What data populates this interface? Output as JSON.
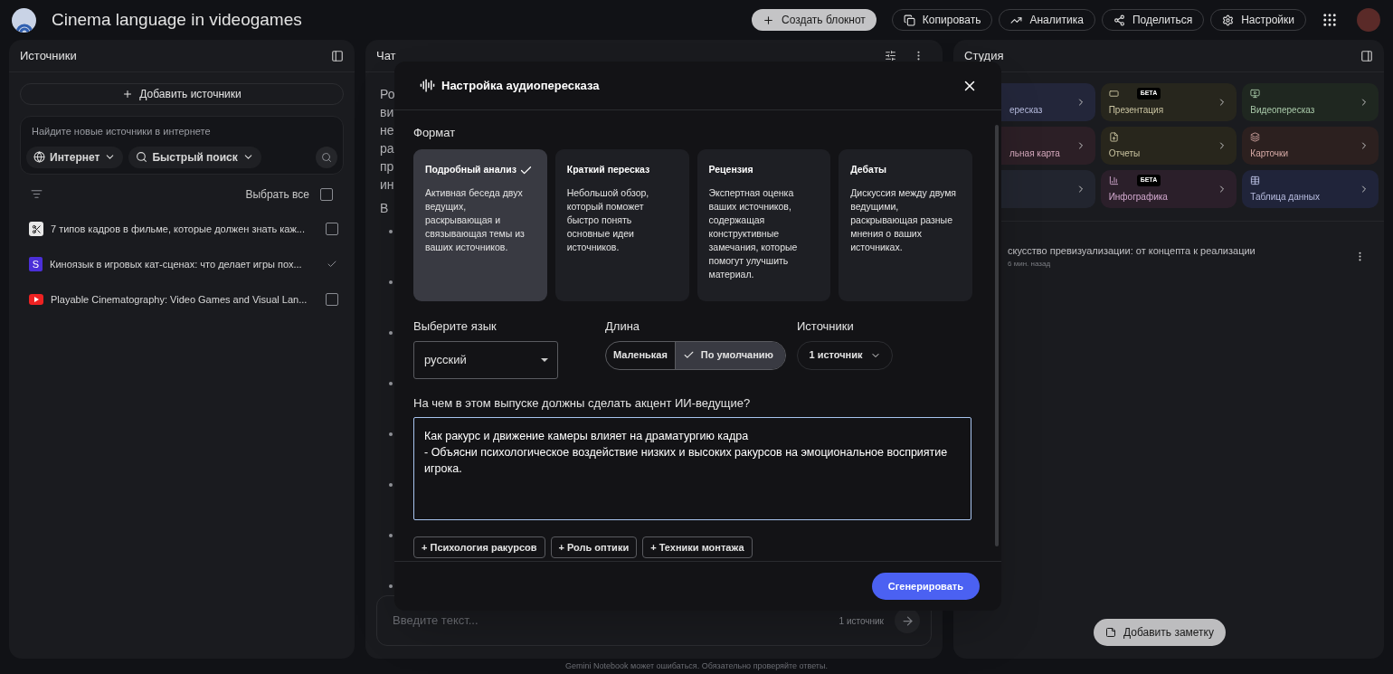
{
  "header": {
    "title": "Cinema language in videogames",
    "buttons": [
      {
        "kind": "create",
        "label": "Создать блокнот"
      },
      {
        "kind": "copy",
        "label": "Копировать"
      },
      {
        "kind": "analytics",
        "label": "Аналитика"
      },
      {
        "kind": "share",
        "label": "Поделиться"
      },
      {
        "kind": "settings",
        "label": "Настройки"
      }
    ]
  },
  "sources": {
    "title": "Источники",
    "add_button": "Добавить источники",
    "search": {
      "placeholder": "Найдите новые источники в интернете",
      "chips": [
        {
          "kind": "web",
          "label": "Интернет"
        },
        {
          "kind": "fast",
          "label": "Быстрый поиск"
        }
      ]
    },
    "select_all": {
      "label": "Выбрать все",
      "checked": false
    },
    "items": [
      {
        "kind": "app",
        "title": "7 типов кадров в фильме, которые должен знать каж...",
        "checked": false
      },
      {
        "kind": "letter",
        "icon_text": "S",
        "title": "Киноязык в игровых кат-сценах: что делает игры пох...",
        "checked": true
      },
      {
        "kind": "video",
        "title": "Playable Cinematography: Video Games and Visual Lan...",
        "checked": false
      }
    ]
  },
  "chat": {
    "title": "Чат",
    "visible_lines": [
      "Ро",
      "ви",
      "не",
      "ра",
      "пр",
      "ин",
      "В"
    ],
    "input": {
      "placeholder": "Введите текст...",
      "source_count": "1 источник"
    }
  },
  "studio": {
    "title": "Студия",
    "tiles": [
      {
        "kind": "audio",
        "label": "ересказ",
        "color": "#23263a"
      },
      {
        "kind": "slides",
        "label": "Презентация",
        "color": "#27261d",
        "badge": "БЕТА"
      },
      {
        "kind": "video",
        "label": "Видеопересказ",
        "color": "#1f2720"
      },
      {
        "kind": "mindmap",
        "label": "льная карта",
        "color": "#2c1f26"
      },
      {
        "kind": "reports",
        "label": "Отчеты",
        "color": "#28261c"
      },
      {
        "kind": "cards",
        "label": "Карточки",
        "color": "#2c201f"
      },
      {
        "kind": "quiz",
        "color": "#22252f"
      },
      {
        "kind": "infographic",
        "label": "Инфографика",
        "color": "#2b1f2a",
        "badge": "БЕТА"
      },
      {
        "kind": "table",
        "label": "Таблица данных",
        "color": "#20243a"
      }
    ],
    "notes": [
      {
        "title": "скусство превизуализации: от концепта к реализации",
        "time": "6 мин. назад"
      }
    ],
    "add_note": "Добавить заметку"
  },
  "dialog": {
    "title": "Настройка аудиопересказа",
    "format_label": "Формат",
    "formats": [
      {
        "title": "Подробный анализ",
        "description": "Активная беседа двух ведущих, раскрывающая и связывающая темы из ваших источников.",
        "selected": true
      },
      {
        "title": "Краткий пересказ",
        "description": "Небольшой обзор, который поможет быстро понять основные идеи источников.",
        "selected": false
      },
      {
        "title": "Рецензия",
        "description": "Экспертная оценка ваших источников, содержащая конструктивные замечания, которые помогут улучшить материал.",
        "selected": false
      },
      {
        "title": "Дебаты",
        "description": "Дискуссия между двумя ведущими, раскрывающая разные мнения о ваших источниках.",
        "selected": false
      }
    ],
    "language": {
      "label": "Выберите язык",
      "value": "русский"
    },
    "length": {
      "label": "Длина",
      "options": [
        {
          "label": "Маленькая",
          "selected": false
        },
        {
          "label": "По умолчанию",
          "selected": true
        }
      ]
    },
    "sources": {
      "label": "Источники",
      "value": "1 источник"
    },
    "focus": {
      "label": "На чем в этом выпуске должны сделать акцент ИИ-ведущие?",
      "value": "Как ракурс и движение камеры влияет на драматургию кадра\n- Объясни психологическое воздействие низких и высоких ракурсов на эмоциональное восприятие игрока."
    },
    "suggestions": [
      "+ Психология ракурсов",
      "+ Роль оптики",
      "+ Техники монтажа"
    ],
    "generate": "Сгенерировать"
  },
  "footer": "Gemini Notebook может ошибаться. Обязательно проверяйте ответы."
}
